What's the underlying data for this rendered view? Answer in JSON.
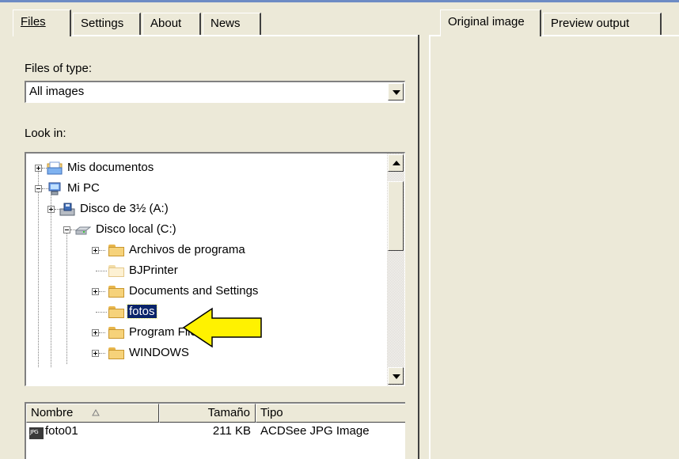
{
  "left_tabs": [
    {
      "label": "Files",
      "active": true
    },
    {
      "label": "Settings",
      "active": false
    },
    {
      "label": "About",
      "active": false
    },
    {
      "label": "News",
      "active": false
    }
  ],
  "right_tabs": [
    {
      "label": "Original image",
      "active": true
    },
    {
      "label": "Preview output",
      "active": false
    }
  ],
  "files_of_type": {
    "label": "Files of type:",
    "value": "All images"
  },
  "look_in": {
    "label": "Look in:"
  },
  "tree": [
    {
      "label": "Mis documentos",
      "icon": "my-documents-icon"
    },
    {
      "label": "Mi PC",
      "icon": "my-computer-icon"
    },
    {
      "label": "Disco de 3½ (A:)",
      "icon": "floppy-drive-icon"
    },
    {
      "label": "Disco local (C:)",
      "icon": "hard-drive-icon"
    },
    {
      "label": "Archivos de programa",
      "icon": "folder-icon"
    },
    {
      "label": "BJPrinter",
      "icon": "folder-icon"
    },
    {
      "label": "Documents and Settings",
      "icon": "folder-icon"
    },
    {
      "label": "fotos",
      "icon": "folder-icon",
      "selected": true
    },
    {
      "label": "Program Files",
      "icon": "folder-icon"
    },
    {
      "label": "WINDOWS",
      "icon": "folder-icon"
    }
  ],
  "file_list": {
    "columns": [
      "Nombre",
      "Tamaño",
      "Tipo"
    ],
    "rows": [
      {
        "name": "foto01",
        "size": "211 KB",
        "type": "ACDSee JPG Image",
        "icon_label": "JPG"
      }
    ]
  },
  "colors": {
    "selection": "#0A246A",
    "arrow": "#FFF200",
    "background": "#ECE9D8"
  }
}
